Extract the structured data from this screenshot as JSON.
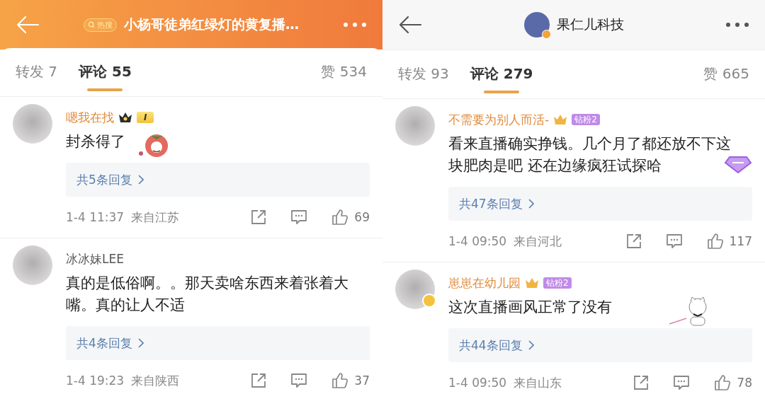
{
  "panels": [
    {
      "header": {
        "kind": "topic",
        "badge": "热搜",
        "title": "小杨哥徒弟红绿灯的黄复播…"
      },
      "tabs": [
        {
          "label": "转发 7",
          "selected": false
        },
        {
          "label": "评论 55",
          "selected": true
        },
        {
          "label": "赞 534",
          "selected": false
        }
      ],
      "comments": [
        {
          "user": "嗯我在找",
          "vip": true,
          "badge": {
            "kind": "crown",
            "text": "I"
          },
          "verified": false,
          "text": "封杀得了",
          "sticker": {
            "kind": "tomato"
          },
          "replies": "共5条回复",
          "time": "1-4 11:37",
          "location": "来自江苏",
          "likes": "69"
        },
        {
          "user": "冰冰妹LEE",
          "vip": false,
          "verified": false,
          "text": "真的是低俗啊。。那天卖啥东西来着张着大嘴。真的让人不适",
          "replies": "共4条回复",
          "time": "1-4 19:23",
          "location": "来自陕西",
          "likes": "37"
        }
      ]
    },
    {
      "header": {
        "kind": "user",
        "title": "果仁儿科技"
      },
      "tabs": [
        {
          "label": "转发 93",
          "selected": false
        },
        {
          "label": "评论 279",
          "selected": true
        },
        {
          "label": "赞 665",
          "selected": false
        }
      ],
      "comments": [
        {
          "user": "不需要为别人而活-",
          "vip": true,
          "badge": {
            "kind": "fan",
            "text": "钻粉2"
          },
          "verified": false,
          "text": "看来直播确实挣钱。几个月了都还放不下这块肥肉是吧 还在边缘疯狂试探哈",
          "sticker": {
            "kind": "gem"
          },
          "replies": "共47条回复",
          "time": "1-4 09:50",
          "location": "来自河北",
          "likes": "117"
        },
        {
          "user": "崽崽在幼儿园",
          "vip": true,
          "badge": {
            "kind": "fan",
            "text": "钻粉2"
          },
          "verified": true,
          "text": "这次直播画风正常了没有",
          "sticker": {
            "kind": "cat"
          },
          "replies": "共44条回复",
          "time": "1-4 09:50",
          "location": "来自山东",
          "likes": "78"
        }
      ]
    }
  ]
}
